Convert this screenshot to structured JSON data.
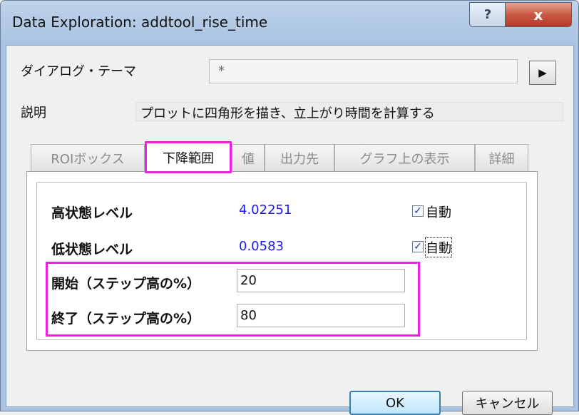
{
  "window": {
    "title": "Data Exploration: addtool_rise_time",
    "help_glyph": "?",
    "close_glyph": "x"
  },
  "theme": {
    "label": "ダイアログ・テーマ",
    "value": "*",
    "arrow_glyph": "▶"
  },
  "description": {
    "label": "説明",
    "value": "プロットに四角形を描き、立上がり時間を計算する"
  },
  "tabs": [
    {
      "label": "ROIボックス",
      "active": false
    },
    {
      "label": "下降範囲",
      "active": true
    },
    {
      "label": "値",
      "active": false
    },
    {
      "label": "出力先",
      "active": false
    },
    {
      "label": "グラフ上の表示",
      "active": false
    },
    {
      "label": "詳細",
      "active": false
    }
  ],
  "fields": {
    "high_level": {
      "label": "高状態レベル",
      "value": "4.02251",
      "auto_label": "自動",
      "auto_checked": true
    },
    "low_level": {
      "label": "低状態レベル",
      "value": "0.0583",
      "auto_label": "自動",
      "auto_checked": true
    },
    "start": {
      "label": "開始（ステップ高の%）",
      "value": "20"
    },
    "end": {
      "label": "終了（ステップ高の%）",
      "value": "80"
    }
  },
  "buttons": {
    "ok": "OK",
    "cancel": "キャンセル"
  },
  "colors": {
    "highlight": "#ee22dd",
    "value_blue": "#1a1af0"
  }
}
